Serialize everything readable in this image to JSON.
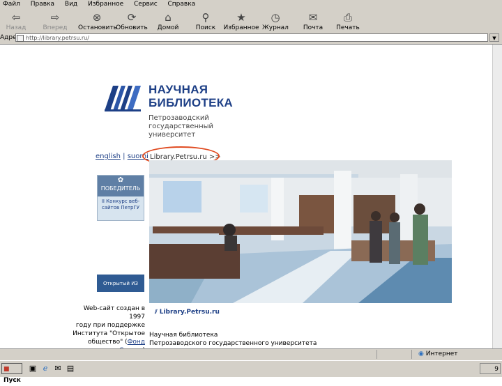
{
  "menu": [
    "Файл",
    "Правка",
    "Вид",
    "Избранное",
    "Сервис",
    "Справка"
  ],
  "toolbar": {
    "back": "Назад",
    "forward": "Вперед",
    "stop": "Остановить",
    "refresh": "Обновить",
    "home": "Домой",
    "search": "Поиск",
    "favorites": "Избранное",
    "history": "Журнал",
    "mail": "Почта",
    "print": "Печать"
  },
  "address": {
    "label": "Адрес",
    "value": "http://library.petrsu.ru/"
  },
  "page": {
    "title_line1": "НАУЧНАЯ",
    "title_line2": "БИБЛИОТЕКА",
    "subtitle_1": "Петрозаводский",
    "subtitle_2": "государственный",
    "subtitle_3": "университет",
    "lang_english": "english",
    "lang_suomi": "suomi",
    "lang_sep": "|",
    "site_link": "Library.Petrsu.ru  >>",
    "banner1_head": "ПОБЕДИТЕЛЬ",
    "banner1_text": "II Конкурс веб-сайтов ПетрГУ",
    "banner2_text": "Открытый ИЗ",
    "footer_link": "Library.Petrsu.ru",
    "info_1": "Web-сайт создан в 1997",
    "info_2": "году при поддержке",
    "info_3": "Института \"Открытое",
    "info_4_prefix": "общество\" (",
    "info_4_link": "Фонд Сороса",
    "info_4_suffix": ")",
    "bottom_1": "Научная библиотека",
    "bottom_2": "Петрозаводского государственного университета"
  },
  "status": {
    "zone": "Интернет"
  },
  "taskbar": {
    "start": "Пуск",
    "tray": "9"
  }
}
